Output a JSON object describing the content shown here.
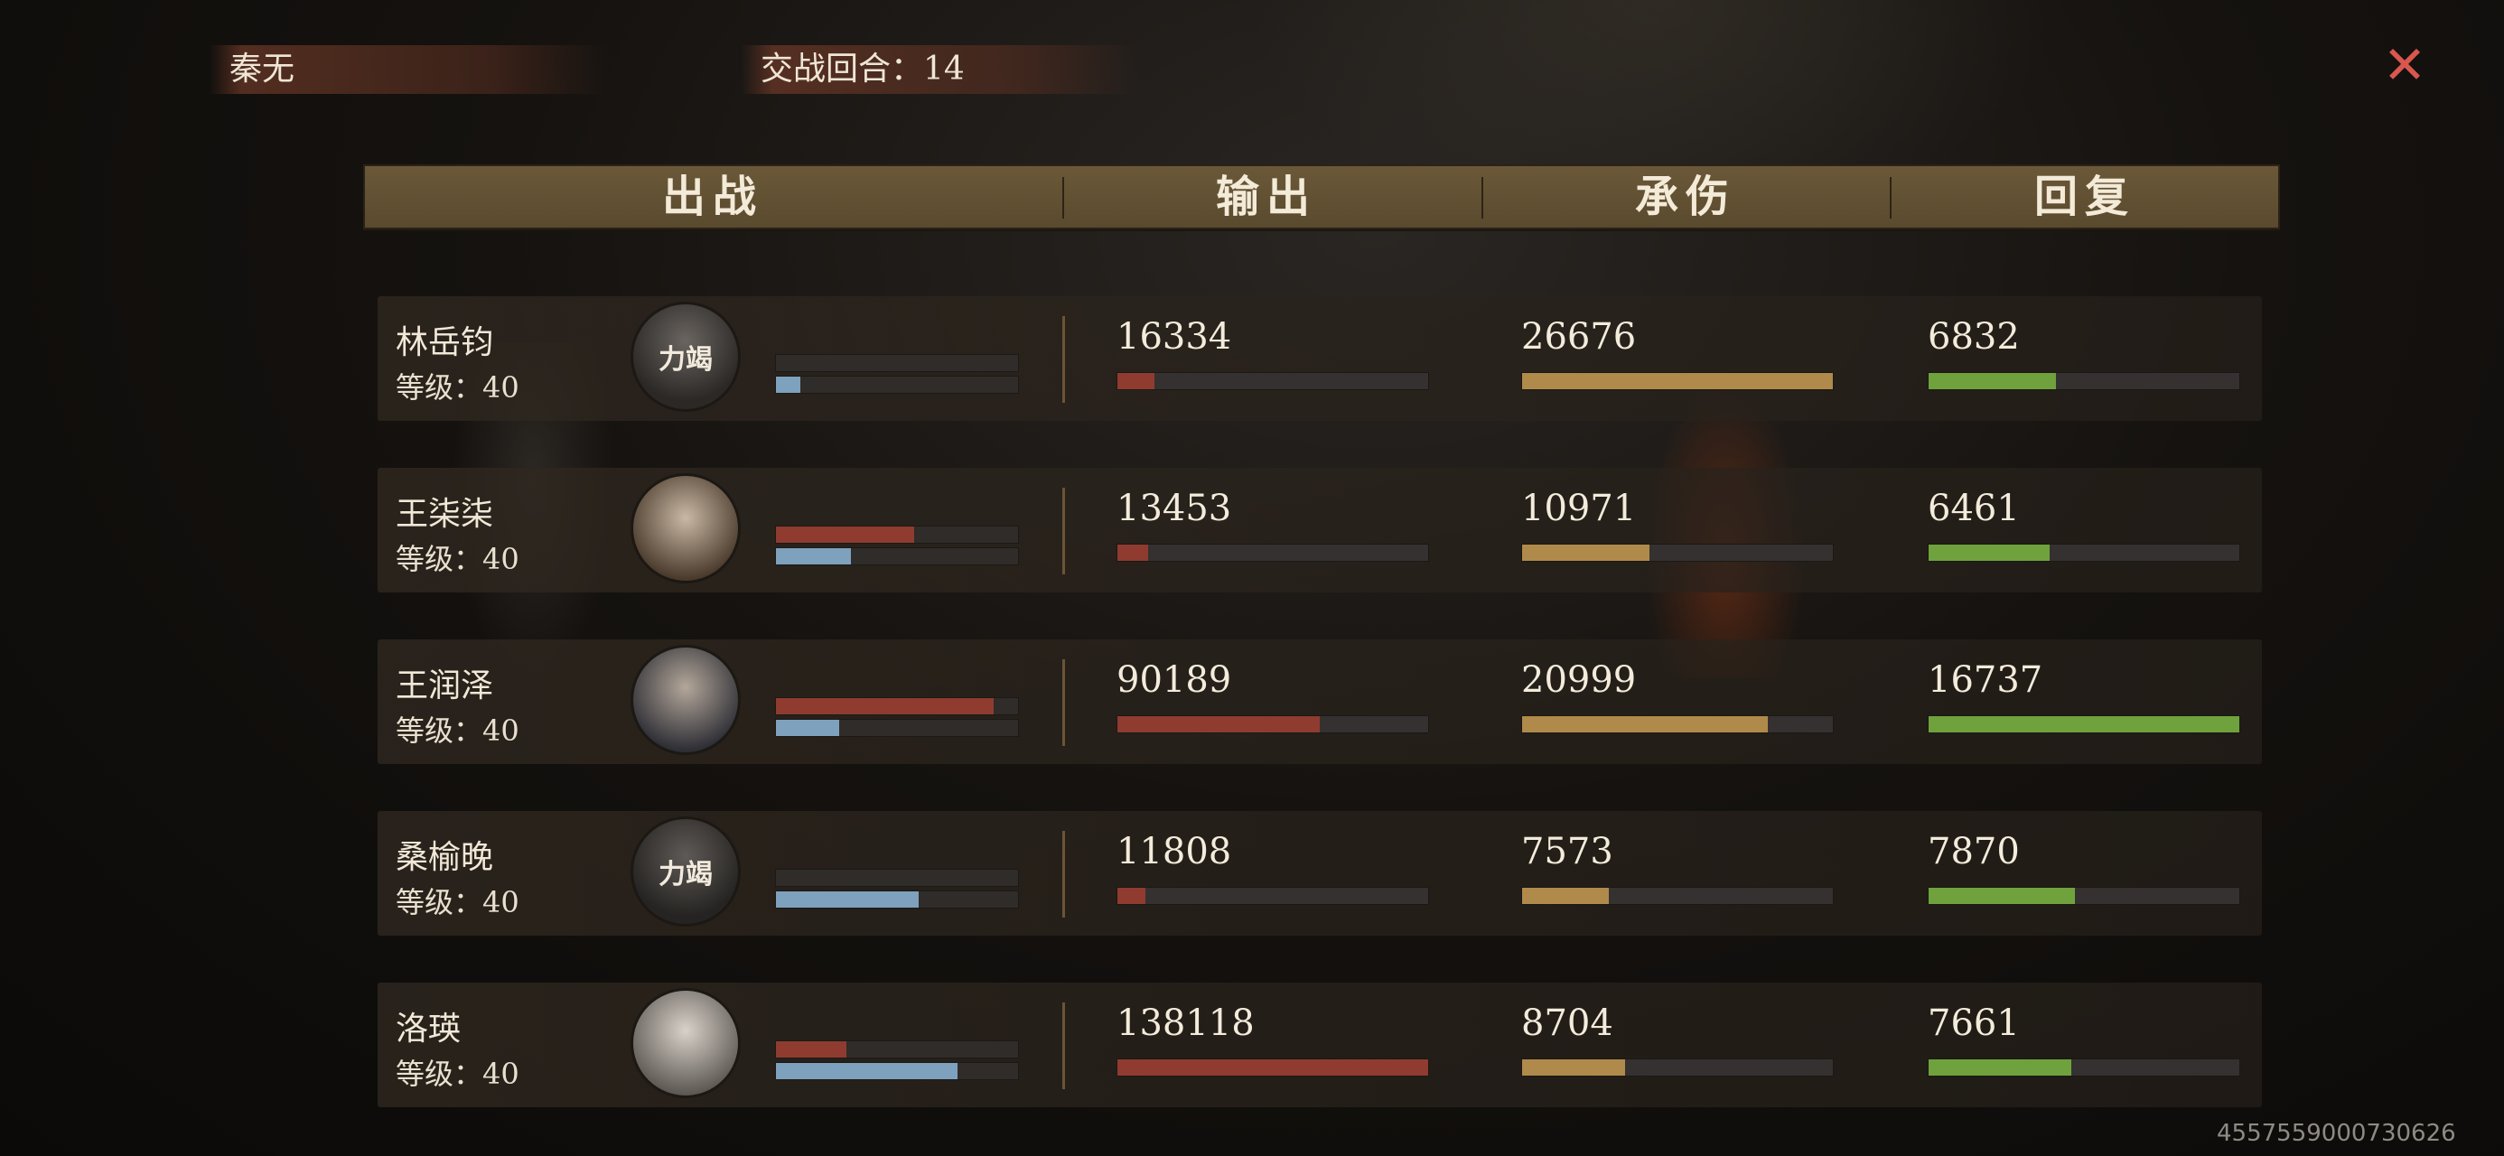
{
  "top": {
    "player_name": "秦无",
    "round_label": "交战回合：14"
  },
  "header": {
    "col_deploy": "出战",
    "col_output": "输出",
    "col_damage_taken": "承伤",
    "col_heal": "回复"
  },
  "rows": [
    {
      "name": "林岳钧",
      "level": "等级：40",
      "avatar_badge": "力竭",
      "avatar_icon": "portrait-male-exhausted-icon",
      "mini_red": 0,
      "mini_blue": 0.1,
      "output": "16334",
      "output_fill": 0.12,
      "taken": "26676",
      "taken_fill": 1.0,
      "heal": "6832",
      "heal_fill": 0.41
    },
    {
      "name": "王柒柒",
      "level": "等级：40",
      "avatar_badge": "",
      "avatar_icon": "portrait-female-yellow-flower-icon",
      "mini_red": 0.57,
      "mini_blue": 0.31,
      "output": "13453",
      "output_fill": 0.1,
      "taken": "10971",
      "taken_fill": 0.41,
      "heal": "6461",
      "heal_fill": 0.39
    },
    {
      "name": "王润泽",
      "level": "等级：40",
      "avatar_badge": "",
      "avatar_icon": "portrait-male-young-icon",
      "mini_red": 0.9,
      "mini_blue": 0.26,
      "output": "90189",
      "output_fill": 0.65,
      "taken": "20999",
      "taken_fill": 0.79,
      "heal": "16737",
      "heal_fill": 1.0
    },
    {
      "name": "桑榆晚",
      "level": "等级：40",
      "avatar_badge": "力竭",
      "avatar_icon": "portrait-female-exhausted-icon",
      "mini_red": 0,
      "mini_blue": 0.59,
      "output": "11808",
      "output_fill": 0.09,
      "taken": "7573",
      "taken_fill": 0.28,
      "heal": "7870",
      "heal_fill": 0.47
    },
    {
      "name": "洛瑛",
      "level": "等级：40",
      "avatar_badge": "",
      "avatar_icon": "portrait-female-white-robe-icon",
      "mini_red": 0.29,
      "mini_blue": 0.75,
      "output": "138118",
      "output_fill": 1.0,
      "taken": "8704",
      "taken_fill": 0.33,
      "heal": "7661",
      "heal_fill": 0.46
    }
  ],
  "uid": "4557559000730626",
  "colors": {
    "output_bar": "#8f3b30",
    "taken_bar": "#b08a4a",
    "heal_bar": "#6fa23c",
    "mini_blue_bar": "#7ea1bd",
    "close_icon": "#d8574f"
  }
}
